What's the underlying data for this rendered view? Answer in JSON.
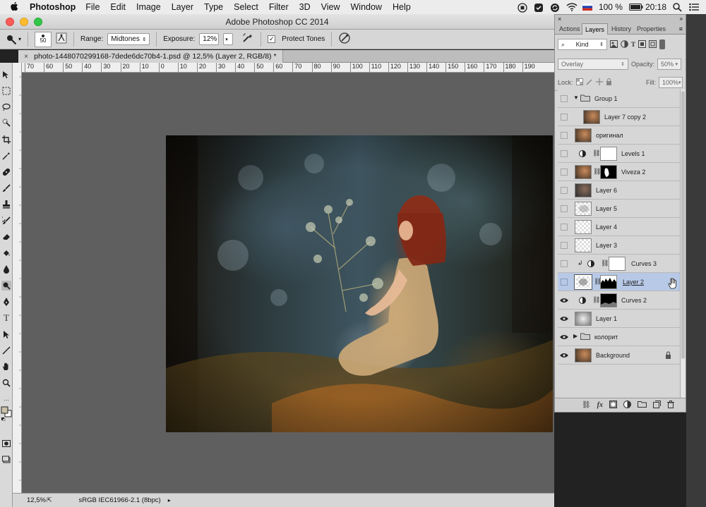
{
  "menubar": {
    "app_name": "Photoshop",
    "items": [
      "File",
      "Edit",
      "Image",
      "Layer",
      "Type",
      "Select",
      "Filter",
      "3D",
      "View",
      "Window",
      "Help"
    ],
    "battery": "100 %",
    "time": "20:18"
  },
  "window": {
    "title": "Adobe Photoshop CC 2014"
  },
  "options_bar": {
    "brush_size": "50",
    "range_label": "Range:",
    "range_value": "Midtones",
    "exposure_label": "Exposure:",
    "exposure_value": "12%",
    "protect_tones_label": "Protect Tones",
    "protect_tones_checked": true
  },
  "document": {
    "tab_title": "photo-1448070299168-7dede6dc70b4-1.psd @ 12,5% (Layer 2, RGB/8) *"
  },
  "ruler": {
    "labels": [
      "70",
      "60",
      "50",
      "40",
      "30",
      "20",
      "10",
      "0",
      "10",
      "20",
      "30",
      "40",
      "50",
      "60",
      "70",
      "80",
      "90",
      "100",
      "110",
      "120",
      "130",
      "140",
      "150",
      "160",
      "170",
      "180",
      "190"
    ]
  },
  "status_bar": {
    "zoom": "12,5%",
    "profile": "sRGB IEC61966-2.1 (8bpc)"
  },
  "layers_panel": {
    "tabs": [
      "Actions",
      "Layers",
      "History",
      "Properties"
    ],
    "active_tab": "Layers",
    "filter_kind": "Kind",
    "blend_mode": "Overlay",
    "opacity_label": "Opacity:",
    "opacity_value": "50%",
    "lock_label": "Lock:",
    "fill_label": "Fill:",
    "fill_value": "100%",
    "layers": [
      {
        "name": "Group 1",
        "visible": false,
        "kind": "group",
        "expanded": true
      },
      {
        "name": "Layer 7 copy 2",
        "visible": false,
        "kind": "pixel",
        "indent": true
      },
      {
        "name": "оригинал",
        "visible": false,
        "kind": "pixel"
      },
      {
        "name": "Levels 1",
        "visible": false,
        "kind": "adjustment"
      },
      {
        "name": "Viveza 2",
        "visible": false,
        "kind": "masked"
      },
      {
        "name": "Layer 6",
        "visible": false,
        "kind": "pixel"
      },
      {
        "name": "Layer 5",
        "visible": false,
        "kind": "pixel"
      },
      {
        "name": "Layer 4",
        "visible": false,
        "kind": "transparent"
      },
      {
        "name": "Layer 3",
        "visible": false,
        "kind": "transparent"
      },
      {
        "name": "Curves 3",
        "visible": false,
        "kind": "adjustment",
        "clipped": true
      },
      {
        "name": "Layer 2",
        "visible": false,
        "kind": "masked",
        "selected": true
      },
      {
        "name": "Curves 2",
        "visible": true,
        "kind": "adjustment"
      },
      {
        "name": "Layer 1",
        "visible": true,
        "kind": "pixel"
      },
      {
        "name": "колорит",
        "visible": true,
        "kind": "group",
        "expanded": false
      },
      {
        "name": "Background",
        "visible": true,
        "kind": "pixel",
        "locked": true
      }
    ]
  }
}
